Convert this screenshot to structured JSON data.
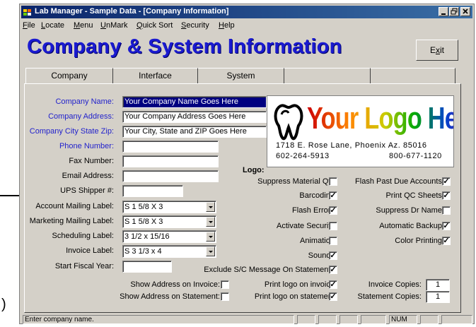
{
  "window": {
    "title": "Lab Manager - Sample Data - [Company Information]",
    "controls": [
      "minimize",
      "restore",
      "close"
    ]
  },
  "menu": [
    {
      "label": "File",
      "accel": "F",
      "rest": "ile"
    },
    {
      "label": "Locate",
      "accel": "L",
      "rest": "ocate"
    },
    {
      "label": "Menu",
      "accel": "M",
      "rest": "enu"
    },
    {
      "label": "UnMark",
      "accel": "U",
      "rest": "nMark"
    },
    {
      "label": "Quick Sort",
      "accel": "Q",
      "rest": "uick Sort"
    },
    {
      "label": "Security",
      "accel": "S",
      "rest": "ecurity"
    },
    {
      "label": "Help",
      "accel": "H",
      "rest": "elp"
    }
  ],
  "heading": "Company & System Information",
  "exit_button": {
    "accel": "x",
    "pre": "E",
    "post": "it"
  },
  "tabs": [
    "Company",
    "Interface",
    "System",
    "",
    ""
  ],
  "company": {
    "name_label": "Company Name:",
    "name_value": "Your Company Name Goes Here",
    "address_label": "Company Address:",
    "address_value": "Your Company Address Goes Here",
    "city_label": "Company City State Zip:",
    "city_value": "Your City, State and ZIP Goes Here",
    "phone_label": "Phone Number:",
    "phone_value": "",
    "fax_label": "Fax Number:",
    "fax_value": "",
    "email_label": "Email Address:",
    "email_value": "",
    "ups_label": "UPS Shipper #:",
    "ups_value": ""
  },
  "labels": {
    "account_label": "Account Mailing Label:",
    "account_value": "S 1 5/8 X 3",
    "marketing_label": "Marketing Mailing Label:",
    "marketing_value": "S 1 5/8 X 3",
    "scheduling_label": "Scheduling Label:",
    "scheduling_value": "3 1/2 x 15/16",
    "invoice_label": "Invoice Label:",
    "invoice_value": "S 3 1/3 x 4",
    "fiscal_label": "Start Fiscal Year:",
    "fiscal_value": ""
  },
  "logo": {
    "label": "Logo:",
    "headline": "Your Logo Here",
    "address": "1718 E. Rose Lane, Phoenix Az. 85016",
    "phone1": "602-264-5913",
    "phone2": "800-677-1120",
    "colors": [
      "#cc0000",
      "#ff8800",
      "#cccc00",
      "#00aa00",
      "#0000cc",
      "#8800aa"
    ]
  },
  "options_mid": [
    {
      "label": "Suppress Material Qty:",
      "checked": false
    },
    {
      "label": "Barcoding:",
      "checked": true
    },
    {
      "label": "Flash Errors:",
      "checked": true
    },
    {
      "label": "Activate Security:",
      "checked": false
    },
    {
      "label": "Animation:",
      "checked": false
    },
    {
      "label": "Sounds:",
      "checked": true
    },
    {
      "label": "Exclude S/C Message On Statements:",
      "checked": true
    }
  ],
  "options_right": [
    {
      "label": "Flash Past Due Accounts:",
      "checked": true
    },
    {
      "label": "Print QC Sheets:",
      "checked": true
    },
    {
      "label": "Suppress Dr Name:",
      "checked": false
    },
    {
      "label": "Automatic Backup:",
      "checked": true
    },
    {
      "label": "Color Printing:",
      "checked": true
    }
  ],
  "bottom": {
    "show_addr_invoice": {
      "label": "Show Address on Invoice:",
      "checked": false
    },
    "show_addr_statement": {
      "label": "Show Address on Statement:",
      "checked": false
    },
    "print_logo_invoice": {
      "label": "Print logo on invoice:",
      "checked": true
    },
    "print_logo_statement": {
      "label": "Print logo on statement:",
      "checked": true
    },
    "invoice_copies_label": "Invoice Copies:",
    "invoice_copies_value": "1",
    "statement_copies_label": "Statement Copies:",
    "statement_copies_value": "1"
  },
  "status": {
    "message": "Enter company name.",
    "num": "NUM"
  },
  "annotation": {
    "stray_text": ")"
  }
}
